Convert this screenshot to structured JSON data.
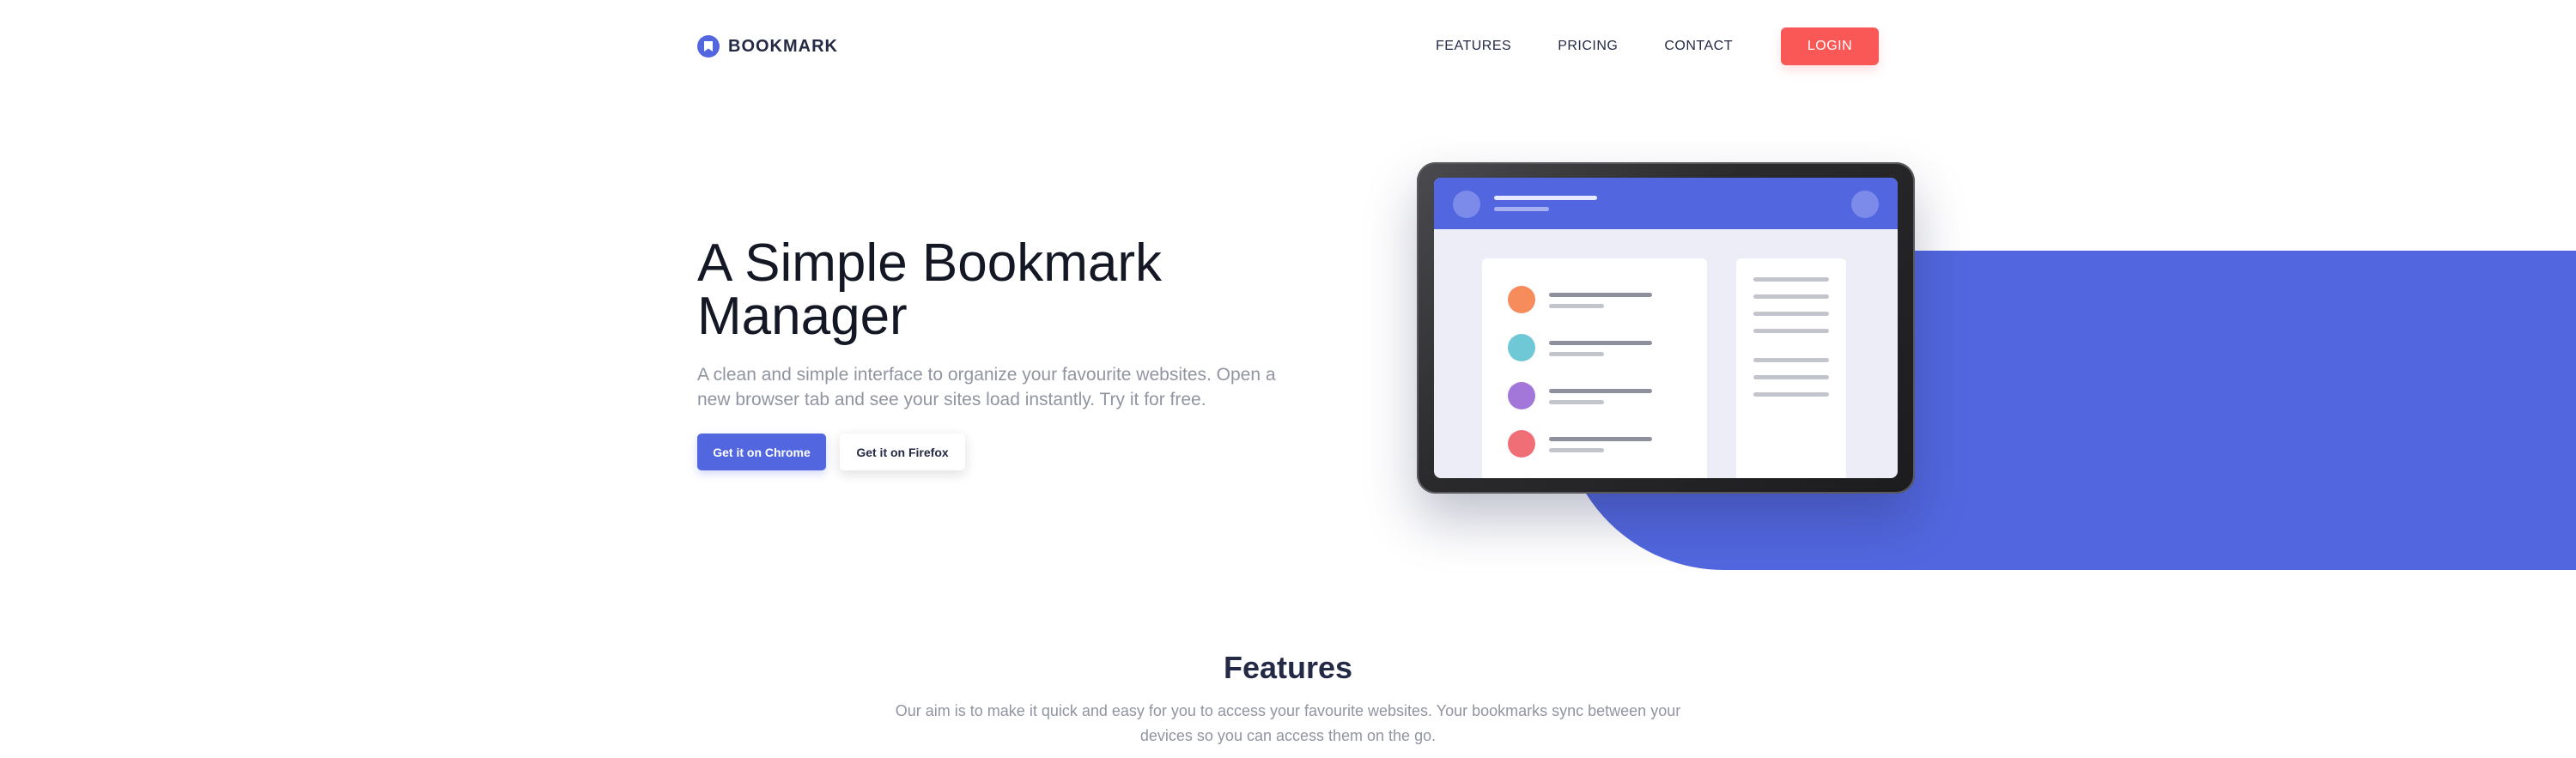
{
  "brand": {
    "name": "BOOKMARK",
    "icon": "bookmark-icon",
    "color": "#5267df"
  },
  "nav": {
    "links": [
      "FEATURES",
      "PRICING",
      "CONTACT"
    ],
    "login_label": "LOGIN",
    "login_color": "#fa5757"
  },
  "hero": {
    "title": "A Simple Bookmark Manager",
    "description": "A clean and simple interface to organize your favourite websites. Open a new browser tab and see your sites load instantly. Try it for free.",
    "primary_button": "Get it on Chrome",
    "secondary_button": "Get it on Firefox"
  },
  "illustration": {
    "bookmark_dot_colors": [
      "#f68b5c",
      "#6fc8d6",
      "#a277d9",
      "#f06f77"
    ]
  },
  "features": {
    "title": "Features",
    "description": "Our aim is to make it quick and easy for you to access your favourite websites. Your bookmarks sync between your devices so you can access them on the go."
  }
}
